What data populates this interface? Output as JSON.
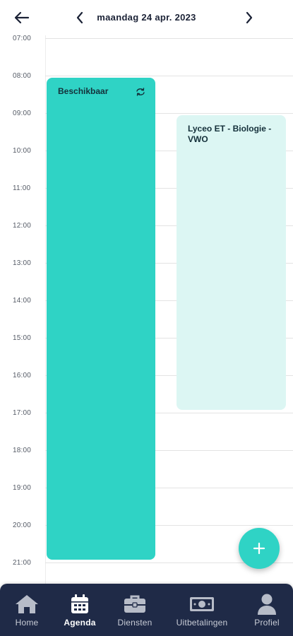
{
  "header": {
    "date_title": "maandag 24 apr. 2023"
  },
  "hours": [
    "07:00",
    "08:00",
    "09:00",
    "10:00",
    "11:00",
    "12:00",
    "13:00",
    "14:00",
    "15:00",
    "16:00",
    "17:00",
    "18:00",
    "19:00",
    "20:00",
    "21:00"
  ],
  "events": [
    {
      "title": "Beschikbaar",
      "start": "08:00",
      "end": "21:00",
      "recurring": true,
      "color": "#2fd3c5"
    },
    {
      "title": "Lyceo ET - Biologie - VWO",
      "start": "09:00",
      "end": "17:00",
      "recurring": false,
      "color": "#dcf6f3"
    }
  ],
  "fab": {
    "icon": "plus-icon"
  },
  "nav": {
    "items": [
      {
        "label": "Home",
        "icon": "home-icon",
        "active": false
      },
      {
        "label": "Agenda",
        "icon": "calendar-icon",
        "active": true
      },
      {
        "label": "Diensten",
        "icon": "briefcase-icon",
        "active": false
      },
      {
        "label": "Uitbetalingen",
        "icon": "money-icon",
        "active": false
      },
      {
        "label": "Profiel",
        "icon": "user-icon",
        "active": false
      }
    ]
  },
  "colors": {
    "accent": "#2fd3c5",
    "accent_light": "#dcf6f3",
    "nav_bg": "#1f2a47",
    "text_dark": "#1b2236"
  }
}
